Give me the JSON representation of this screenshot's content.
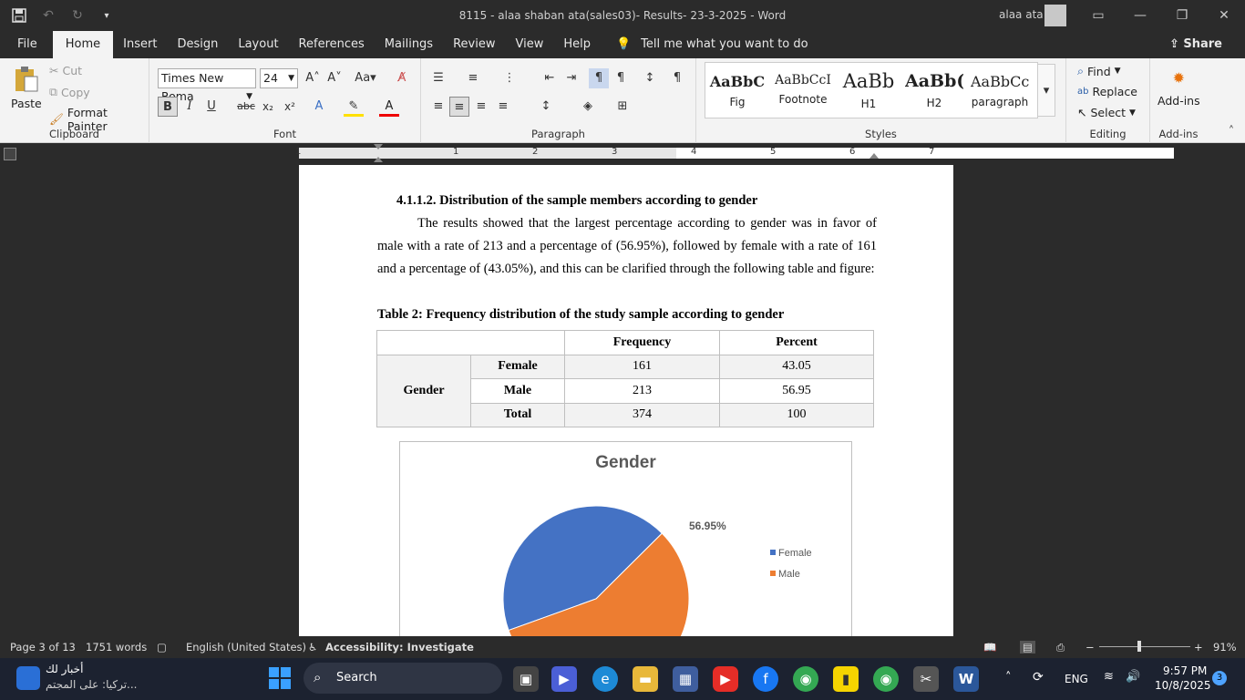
{
  "window": {
    "title": "8115 - alaa shaban ata(sales03)- Results- 23-3-2025  -  Word",
    "user": "alaa ata"
  },
  "menu": {
    "file": "File",
    "home": "Home",
    "insert": "Insert",
    "design": "Design",
    "layout": "Layout",
    "references": "References",
    "mailings": "Mailings",
    "review": "Review",
    "view": "View",
    "help": "Help",
    "tell": "Tell me what you want to do",
    "share": "Share"
  },
  "ribbon": {
    "clipboard": {
      "paste": "Paste",
      "cut": "Cut",
      "copy": "Copy",
      "format_painter": "Format Painter",
      "label": "Clipboard"
    },
    "font": {
      "name": "Times New Roma",
      "size": "24",
      "label": "Font"
    },
    "paragraph": {
      "label": "Paragraph"
    },
    "styles": {
      "label": "Styles",
      "items": [
        {
          "preview": "AaBbC",
          "name": "Fig"
        },
        {
          "preview": "AaBbCcI",
          "name": "Footnote"
        },
        {
          "preview": "AaBb",
          "name": "H1"
        },
        {
          "preview": "AaBb(",
          "name": "H2"
        },
        {
          "preview": "AaBbCc",
          "name": "paragraph"
        }
      ]
    },
    "editing": {
      "find": "Find",
      "replace": "Replace",
      "select": "Select",
      "label": "Editing"
    },
    "addins": {
      "button": "Add-ins",
      "label": "Add-ins"
    }
  },
  "ruler": {
    "numbers": [
      "1",
      "1",
      "2",
      "3",
      "4",
      "5",
      "6",
      "7"
    ]
  },
  "document": {
    "heading": "4.1.1.2. Distribution of the sample members according to gender",
    "paragraph": "The results showed that the largest percentage according to gender was in favor of male with a rate of 213 and a percentage of (56.95%), followed by female with a rate of 161 and a percentage of (43.05%), and this can be clarified through the following table and figure:",
    "table_caption": "Table 2: Frequency distribution of the study sample according to gender",
    "table": {
      "headers": [
        "Frequency",
        "Percent"
      ],
      "group": "Gender",
      "rows": [
        {
          "label": "Female",
          "frequency": "161",
          "percent": "43.05"
        },
        {
          "label": "Male",
          "frequency": "213",
          "percent": "56.95"
        },
        {
          "label": "Total",
          "frequency": "374",
          "percent": "100"
        }
      ]
    }
  },
  "chart_data": {
    "type": "pie",
    "title": "Gender",
    "categories": [
      "Female",
      "Male"
    ],
    "values": [
      43.05,
      56.95
    ],
    "data_labels": [
      "",
      "56.95%"
    ],
    "colors": [
      "#4472c4",
      "#ed7d31"
    ],
    "legend": "right"
  },
  "status": {
    "page": "Page 3 of 13",
    "words": "1751 words",
    "language": "English (United States)",
    "accessibility": "Accessibility: Investigate",
    "zoom": "91%"
  },
  "taskbar": {
    "news_title": "أخبار لك",
    "news_sub": "تركيا: على المجتم...",
    "search": "Search",
    "lang": "ENG",
    "time": "9:57 PM",
    "date": "10/8/2025",
    "badge": "3"
  }
}
